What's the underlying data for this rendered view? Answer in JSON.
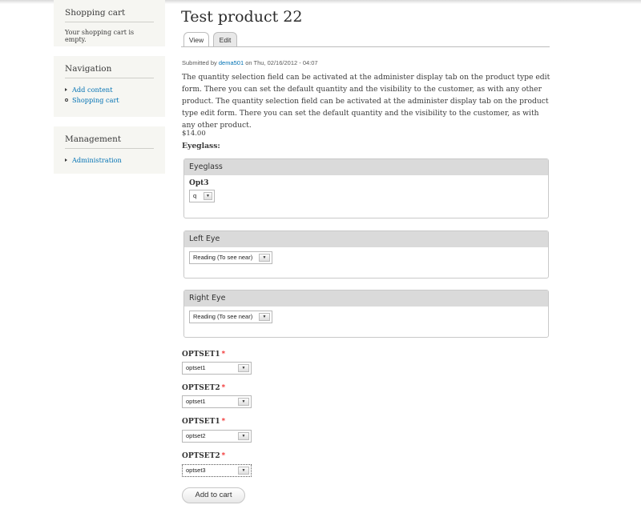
{
  "sidebar": {
    "cart": {
      "title": "Shopping cart",
      "empty_text": "Your shopping cart is empty."
    },
    "navigation": {
      "title": "Navigation",
      "items": [
        {
          "label": "Add content"
        },
        {
          "label": "Shopping cart"
        }
      ]
    },
    "management": {
      "title": "Management",
      "items": [
        {
          "label": "Administration"
        }
      ]
    }
  },
  "page": {
    "title": "Test product 22",
    "tabs": [
      {
        "label": "View",
        "active": true
      },
      {
        "label": "Edit",
        "active": false
      }
    ],
    "submitted": {
      "prefix": "Submitted by",
      "author": "dema501",
      "suffix": "on Thu, 02/16/2012 - 04:07"
    },
    "body": "The quantity selection field can be activated at the administer display tab on the product type edit form. There you can set the default quantity and the visibility to the customer, as with any other product. The quantity selection field can be activated at the administer display tab on the product type edit form. There you can set the default quantity and the visibility to the customer, as with any other product.",
    "price": "$14.00",
    "attribute_title": "Eyeglass:"
  },
  "fieldsets": {
    "eyeglass": {
      "legend": "Eyeglass",
      "label": "Opt3",
      "value": "q"
    },
    "left_eye": {
      "legend": "Left Eye",
      "value": "Reading (To see near)"
    },
    "right_eye": {
      "legend": "Right Eye",
      "value": "Reading (To see near)"
    }
  },
  "optsets": [
    {
      "label": "OPTSET1",
      "required": "*",
      "value": "optset1"
    },
    {
      "label": "OPTSET2",
      "required": "*",
      "value": "optset1"
    },
    {
      "label": "OPTSET1",
      "required": "*",
      "value": "optset2"
    },
    {
      "label": "OPTSET2",
      "required": "*",
      "value": "optset3"
    }
  ],
  "actions": {
    "add_to_cart": "Add to cart"
  },
  "icons": {
    "dropdown": "chevron-down-icon",
    "bullet_leaf": "triangle-bullet-icon",
    "bullet_expanded": "circle-bullet-icon"
  },
  "colors": {
    "link": "#0071b3",
    "required": "#ee0000",
    "legend_bg": "#dadada",
    "sidebar_bg": "#f6f6f2"
  }
}
